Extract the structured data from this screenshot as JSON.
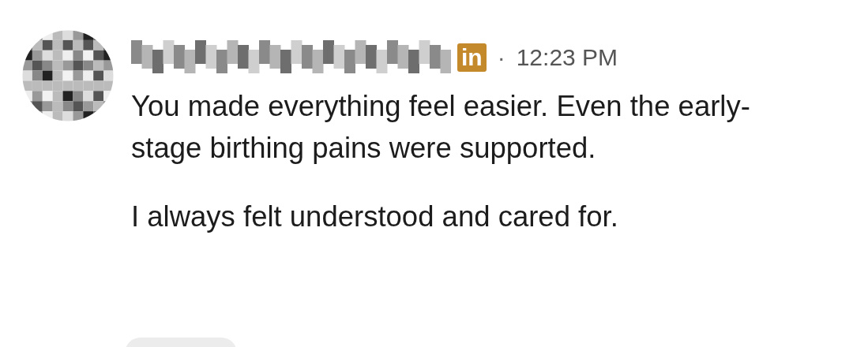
{
  "message": {
    "badge": "in",
    "separator": "·",
    "time": "12:23 PM",
    "paragraphs": [
      "You made everything feel easier. Even the early-stage birthing pains were supported.",
      "I always felt understood and cared for."
    ]
  }
}
